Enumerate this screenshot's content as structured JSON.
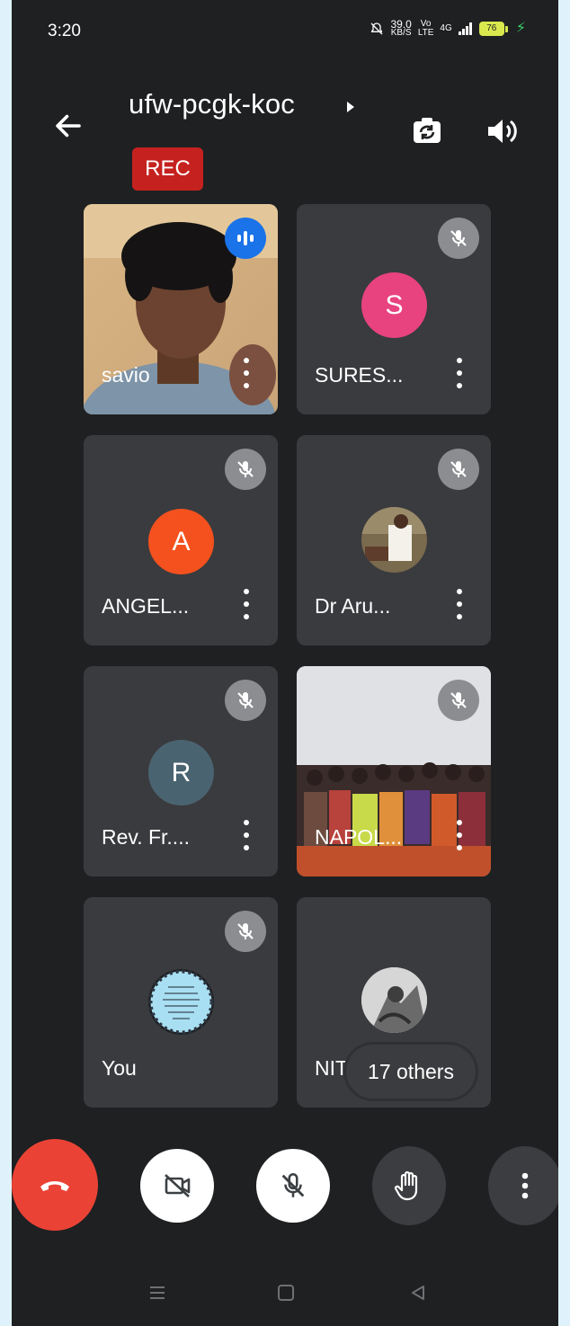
{
  "status_bar": {
    "time": "3:20",
    "speed_value": "39.0",
    "speed_unit": "KB/S",
    "volte_top": "Vo",
    "volte_bottom": "LTE",
    "network": "4G",
    "battery": "76"
  },
  "header": {
    "meeting_code": "ufw-pcgk-koc",
    "rec_label": "REC"
  },
  "participants": [
    {
      "name": "savio",
      "type": "video",
      "speaking": true
    },
    {
      "name": "SURES...",
      "type": "letter",
      "letter": "S",
      "avatar_color": "#e8437f",
      "muted": true
    },
    {
      "name": "ANGEL...",
      "type": "letter",
      "letter": "A",
      "avatar_color": "#f4511e",
      "muted": true
    },
    {
      "name": "Dr Aru...",
      "type": "photo",
      "muted": true
    },
    {
      "name": "Rev. Fr....",
      "type": "letter",
      "letter": "R",
      "avatar_color": "#4a6371",
      "muted": true
    },
    {
      "name": "NAPOL...",
      "type": "video",
      "muted": true
    },
    {
      "name": "You",
      "type": "photo",
      "muted": true
    },
    {
      "name": "NITHEESHWAR",
      "type": "photo"
    }
  ],
  "others_count_label": "17 others",
  "controls": {
    "end_call_icon": "phone-hangup-icon",
    "camera_icon": "video-off-icon",
    "mic_icon": "mic-off-icon",
    "hand_icon": "raise-hand-icon",
    "more_icon": "more-vert-icon"
  },
  "colors": {
    "background": "#1f2022",
    "tile": "#3a3b3e",
    "rec": "#c5221f",
    "end_call": "#ea4335",
    "speaking": "#1a73e8"
  }
}
